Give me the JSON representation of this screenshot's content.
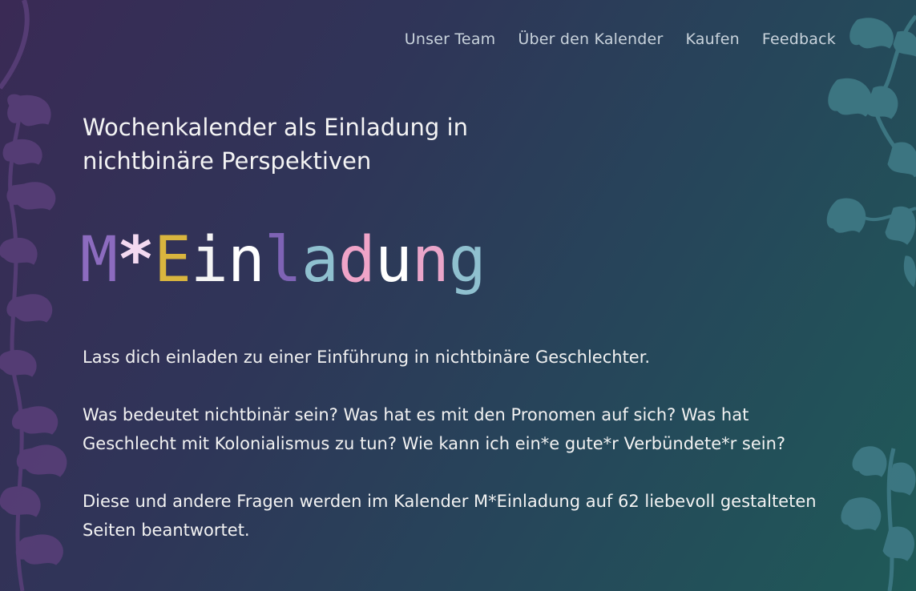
{
  "nav": {
    "items": [
      {
        "label": "Unser Team"
      },
      {
        "label": "Über den Kalender"
      },
      {
        "label": "Kaufen"
      },
      {
        "label": "Feedback"
      }
    ]
  },
  "hero": {
    "tagline": "Wochenkalender als Einladung in nichtbinäre Perspektiven",
    "logo": {
      "letters": [
        {
          "char": "M",
          "color": "#8c6bbf"
        },
        {
          "char": "*",
          "color": "#f3d9f0"
        },
        {
          "char": "E",
          "color": "#d9b53e"
        },
        {
          "char": "i",
          "color": "#f4f4f4"
        },
        {
          "char": "n",
          "color": "#ffffff"
        },
        {
          "char": "l",
          "color": "#7e63b5"
        },
        {
          "char": "a",
          "color": "#8fc0cf"
        },
        {
          "char": "d",
          "color": "#f0a4c8"
        },
        {
          "char": "u",
          "color": "#ffffff"
        },
        {
          "char": "n",
          "color": "#eaa5c9"
        },
        {
          "char": "g",
          "color": "#8fc0cf"
        }
      ]
    }
  },
  "content": {
    "paragraph_1": "Lass dich einladen zu einer Einführung in nichtbinäre Geschlechter.",
    "paragraph_2": "Was bedeutet nichtbinär sein? Was hat es mit den Pronomen auf sich? Was hat Geschlecht mit Kolonialismus zu tun? Wie kann ich ein*e gute*r Verbündete*r sein?",
    "paragraph_3": "Diese und andere Fragen werden im Kalender M*Einladung auf 62 liebevoll gestalteten Seiten beantwortet."
  },
  "colors": {
    "leaf_left": "#5a3f7a",
    "leaf_right": "#3f7a86"
  }
}
